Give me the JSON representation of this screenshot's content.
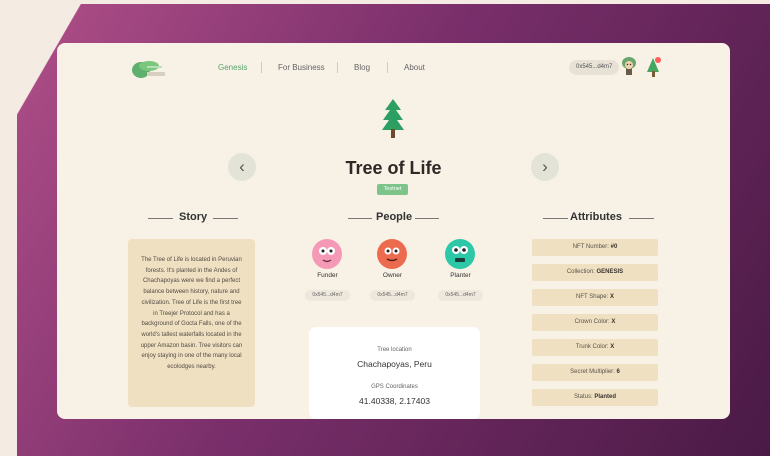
{
  "nav": {
    "items": [
      "Genesis",
      "For Business",
      "Blog",
      "About"
    ],
    "wallet": "0x545...d4m7"
  },
  "hero": {
    "title": "Tree of Life",
    "badge": "Testnet"
  },
  "sections": {
    "story": "Story",
    "people": "People",
    "attributes": "Attributes"
  },
  "story": {
    "text": "The Tree of Life is located in Peruvian forests. It's planted in the Andes of Chachapoyas were we find a perfect balance between history, nature and civilization. Tree of Life is the first tree in Treejer Protocol and has a background of Gocta Falls, one of the world's tallest waterfalls located in the upper Amazon basin. Tree visitors can enjoy staying in one of the many local ecolodges nearby."
  },
  "people": [
    {
      "role": "Funder",
      "address": "0x545...d4m7",
      "color": "#f49ab7"
    },
    {
      "role": "Owner",
      "address": "0x545...d4m7",
      "color": "#ec6b4e"
    },
    {
      "role": "Planter",
      "address": "0x545...d4m7",
      "color": "#2cc8a8"
    }
  ],
  "location": {
    "label": "Tree location",
    "place": "Chachapoyas, Peru",
    "gps_label": "GPS Coordinates",
    "gps": "41.40338, 2.17403"
  },
  "attributes": [
    {
      "label": "NFT Number:",
      "value": "#0"
    },
    {
      "label": "Collection:",
      "value": "GENESIS"
    },
    {
      "label": "NFT Shape:",
      "value": "X"
    },
    {
      "label": "Crown Color:",
      "value": "X"
    },
    {
      "label": "Trunk Color:",
      "value": "X"
    },
    {
      "label": "Secret Multiplier:",
      "value": "6"
    },
    {
      "label": "Status:",
      "value": "Planted"
    }
  ],
  "icons": {
    "logo": "treejer-logo-icon",
    "prev": "chevron-left-icon",
    "next": "chevron-right-icon",
    "avatar": "avatar-icon",
    "notification": "tree-notification-icon"
  }
}
